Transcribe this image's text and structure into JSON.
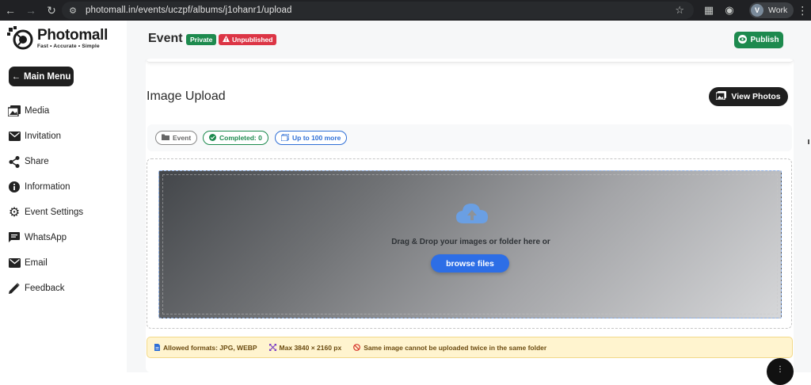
{
  "browser": {
    "url": "photomall.in/events/uczpf/albums/j1ohanr1/upload",
    "profile_initial": "V",
    "profile_label": "Work"
  },
  "brand": {
    "name": "Photomall",
    "tagline": "Fast • Accurate • Simple"
  },
  "sidebar": {
    "main_menu_label": "Main Menu",
    "items": [
      {
        "label": "Media",
        "icon": "photo-library-icon"
      },
      {
        "label": "Invitation",
        "icon": "mail-icon"
      },
      {
        "label": "Share",
        "icon": "share-icon"
      },
      {
        "label": "Information",
        "icon": "info-icon"
      },
      {
        "label": "Event Settings",
        "icon": "gear-icon"
      },
      {
        "label": "WhatsApp",
        "icon": "chat-icon"
      },
      {
        "label": "Email",
        "icon": "mail-icon"
      },
      {
        "label": "Feedback",
        "icon": "pencil-icon"
      }
    ]
  },
  "header": {
    "title": "Event",
    "badge_private": "Private",
    "badge_unpublished": "Unpublished",
    "publish_label": "Publish"
  },
  "upload": {
    "title": "Image Upload",
    "view_photos_label": "View Photos",
    "chips": {
      "event": "Event",
      "completed": "Completed:  0",
      "more": "Up to  100  more"
    },
    "drop_text": "Drag & Drop your images or folder here or",
    "browse_label": "browse files",
    "info": {
      "formats": "Allowed formats: JPG, WEBP",
      "max_size": "Max 3840 × 2160 px",
      "duplicate": "Same image cannot be uploaded twice in the same folder"
    }
  },
  "colors": {
    "accent_green": "#1d8a4e",
    "accent_red": "#dc3545",
    "accent_blue": "#2d6ee6",
    "dark_button": "#1f1f1f"
  }
}
